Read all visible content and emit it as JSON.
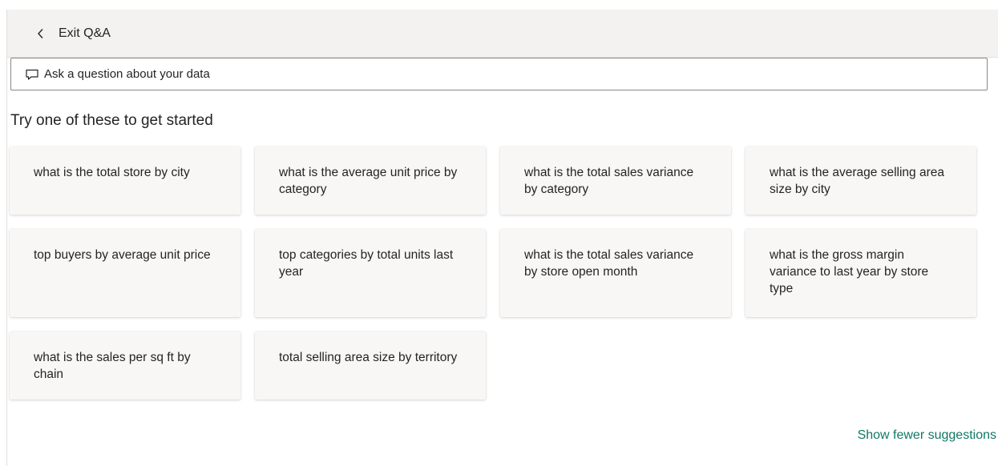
{
  "header": {
    "exit_label": "Exit Q&A"
  },
  "question_box": {
    "placeholder": "Ask a question about your data"
  },
  "suggestions": {
    "heading": "Try one of these to get started",
    "items": [
      "what is the total store by city",
      "what is the average unit price by category",
      "what is the total sales variance by category",
      "what is the average selling area size by city",
      "top buyers by average unit price",
      "top categories by total units last year",
      "what is the total sales variance by store open month",
      "what is the gross margin variance to last year by store type",
      "what is the sales per sq ft by chain",
      "total selling area size by territory"
    ],
    "toggle_label": "Show fewer suggestions"
  },
  "colors": {
    "link": "#117865",
    "header_bg": "#f3f2f1",
    "card_bg": "#f8f7f6"
  },
  "icons": {
    "back": "chevron-left-icon",
    "question": "speech-bubble-icon"
  }
}
